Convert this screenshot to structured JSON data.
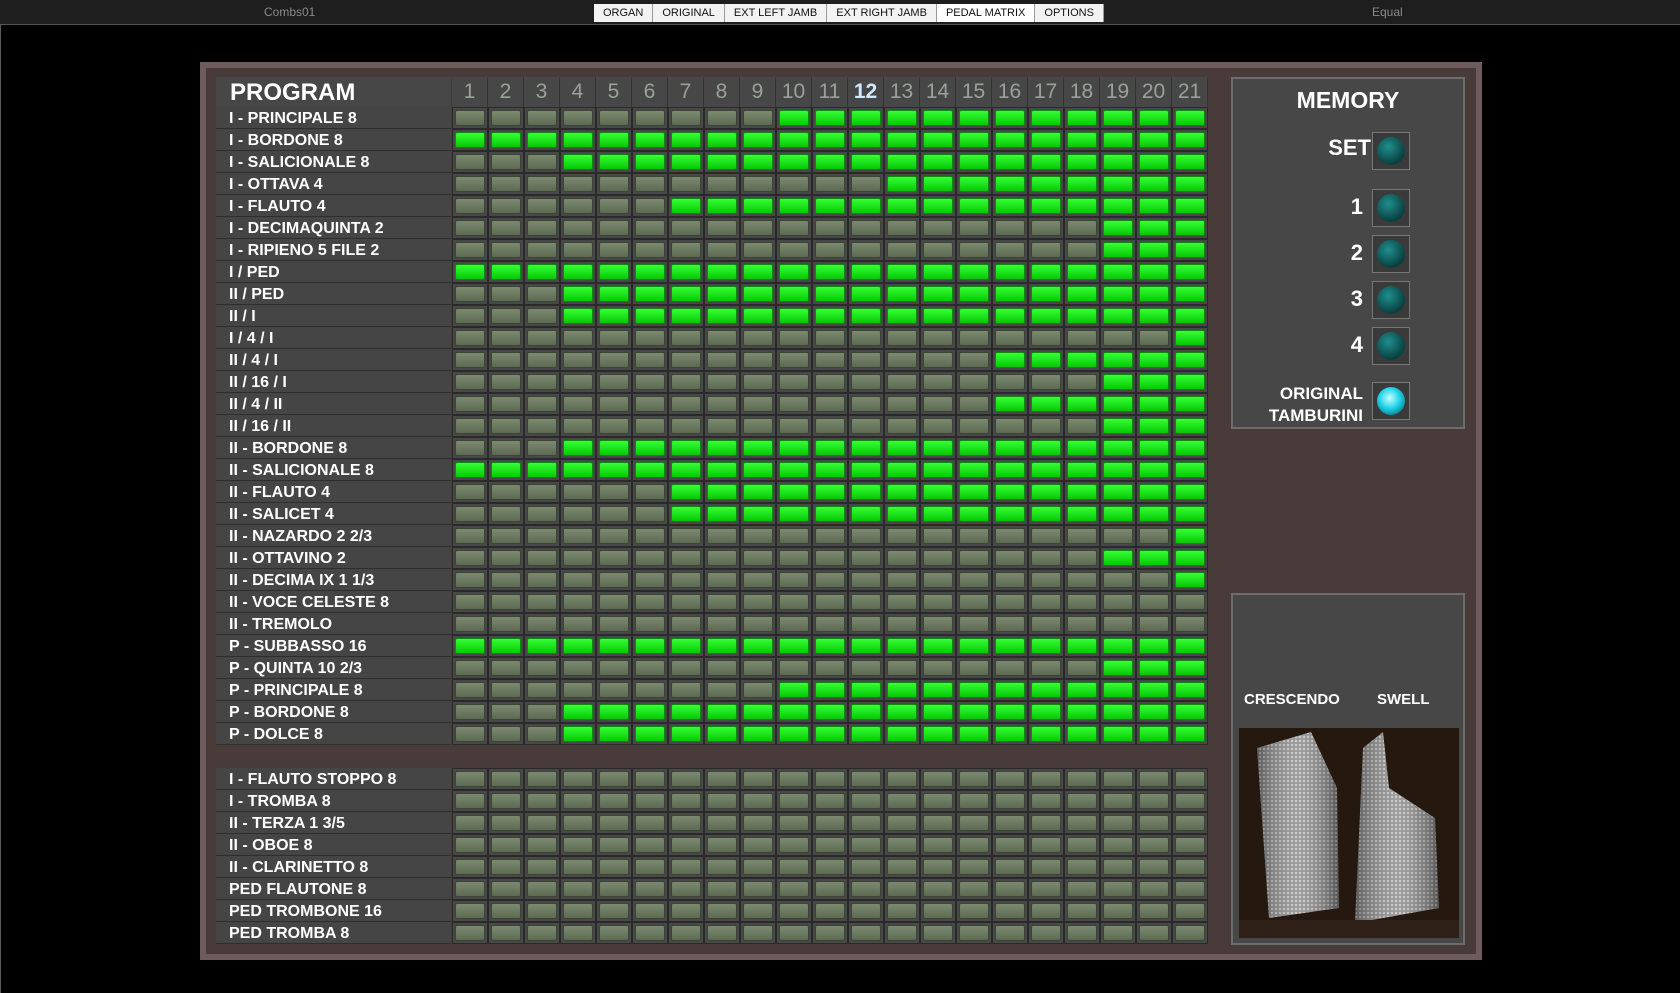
{
  "top": {
    "combination": "Combs01",
    "temperament": "Equal",
    "tabs": [
      {
        "label": "ORGAN",
        "active": false
      },
      {
        "label": "ORIGINAL",
        "active": false
      },
      {
        "label": "EXT LEFT JAMB",
        "active": false
      },
      {
        "label": "EXT RIGHT JAMB",
        "active": false
      },
      {
        "label": "PEDAL MATRIX",
        "active": true
      },
      {
        "label": "OPTIONS",
        "active": false
      }
    ]
  },
  "matrix": {
    "title": "PROGRAM",
    "current_column": 12,
    "columns": [
      "1",
      "2",
      "3",
      "4",
      "5",
      "6",
      "7",
      "8",
      "9",
      "10",
      "11",
      "12",
      "13",
      "14",
      "15",
      "16",
      "17",
      "18",
      "19",
      "20",
      "21"
    ],
    "rows": [
      {
        "label": "I - PRINCIPALE 8",
        "from": 10
      },
      {
        "label": "I - BORDONE 8",
        "from": 1
      },
      {
        "label": "I - SALICIONALE 8",
        "from": 4
      },
      {
        "label": "I - OTTAVA 4",
        "from": 13
      },
      {
        "label": "I - FLAUTO 4",
        "from": 7
      },
      {
        "label": "I - DECIMAQUINTA 2",
        "from": 19
      },
      {
        "label": "I - RIPIENO 5 FILE 2",
        "from": 19
      },
      {
        "label": "I / PED",
        "from": 1
      },
      {
        "label": "II / PED",
        "from": 4
      },
      {
        "label": "II / I",
        "from": 4
      },
      {
        "label": "I / 4 / I",
        "from": 21
      },
      {
        "label": "II / 4 / I",
        "from": 16
      },
      {
        "label": "II / 16 / I",
        "from": 19
      },
      {
        "label": "II / 4 / II",
        "from": 16
      },
      {
        "label": "II / 16 / II",
        "from": 19
      },
      {
        "label": "II - BORDONE 8",
        "from": 4
      },
      {
        "label": "II - SALICIONALE 8",
        "from": 1
      },
      {
        "label": "II - FLAUTO 4",
        "from": 7
      },
      {
        "label": "II - SALICET 4",
        "from": 7
      },
      {
        "label": "II - NAZARDO 2 2/3",
        "from": 21
      },
      {
        "label": "II - OTTAVINO 2",
        "from": 19
      },
      {
        "label": "II - DECIMA IX 1 1/3",
        "from": 21
      },
      {
        "label": "II - VOCE CELESTE 8",
        "from": 0
      },
      {
        "label": "II - TREMOLO",
        "from": 0
      },
      {
        "label": "P - SUBBASSO 16",
        "from": 1
      },
      {
        "label": "P - QUINTA 10 2/3",
        "from": 19
      },
      {
        "label": "P - PRINCIPALE 8",
        "from": 10
      },
      {
        "label": "P - BORDONE 8",
        "from": 4
      },
      {
        "label": "P - DOLCE 8",
        "from": 4
      }
    ],
    "extra_rows": [
      {
        "label": "I - FLAUTO STOPPO 8",
        "from": 0
      },
      {
        "label": "I - TROMBA 8",
        "from": 0
      },
      {
        "label": "II - TERZA 1 3/5",
        "from": 0
      },
      {
        "label": "II - OBOE 8",
        "from": 0
      },
      {
        "label": "II - CLARINETTO 8",
        "from": 0
      },
      {
        "label": "PED FLAUTONE 8",
        "from": 0
      },
      {
        "label": "PED TROMBONE 16",
        "from": 0
      },
      {
        "label": "PED TROMBA 8",
        "from": 0
      }
    ]
  },
  "memory": {
    "title": "MEMORY",
    "set_label": "SET",
    "slots": [
      "1",
      "2",
      "3",
      "4"
    ],
    "original_label_1": "ORIGINAL",
    "original_label_2": "TAMBURINI",
    "original_lit": true
  },
  "pedals": {
    "crescendo_label": "CRESCENDO",
    "swell_label": "SWELL"
  },
  "colors": {
    "on": "#1ee61e",
    "off": "#6b7a60",
    "panel": "#4a3b3b"
  }
}
